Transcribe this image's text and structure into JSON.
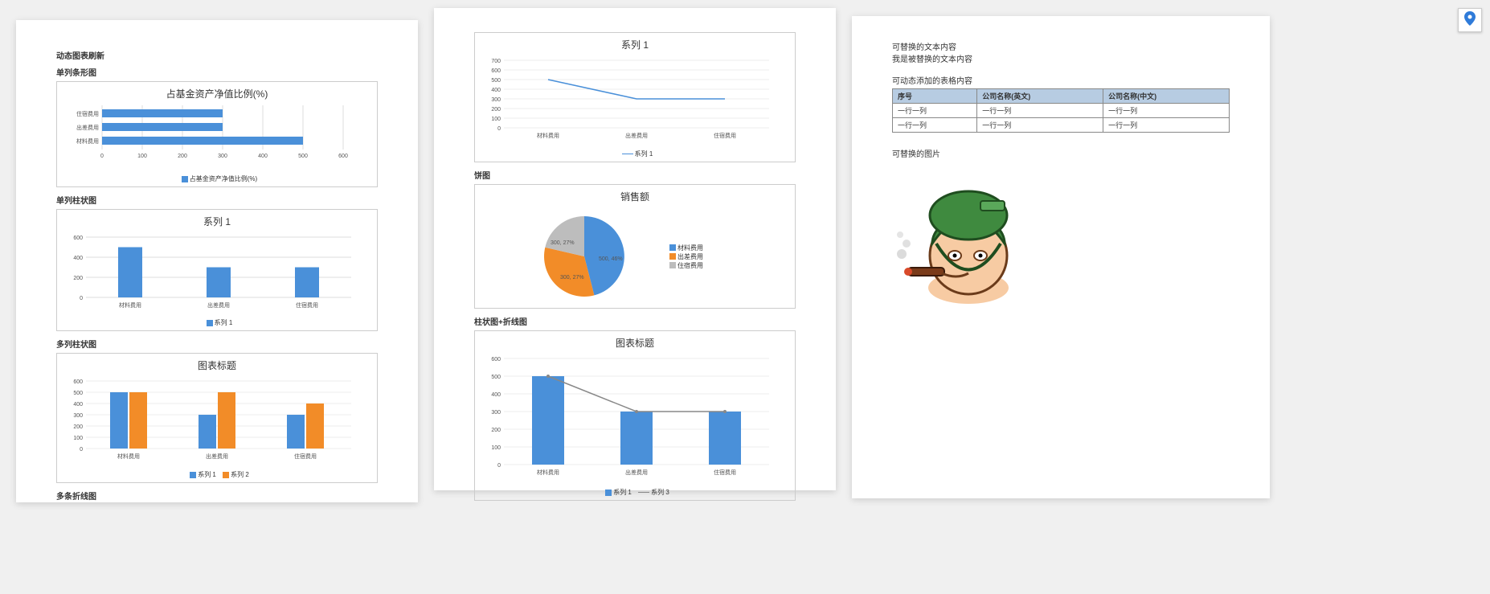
{
  "headings": {
    "main": "动态图表刷新",
    "bar_single": "单列条形图",
    "col_single": "单列柱状图",
    "col_multi": "多列柱状图",
    "line_multi": "多条折线图",
    "pie": "饼图",
    "combo": "柱状图+折线图",
    "text_section": "可替换的文本内容",
    "text_body": "我是被替换的文本内容",
    "table_section": "可动态添加的表格内容",
    "image_section": "可替换的图片"
  },
  "chart_data": [
    {
      "id": "hbar",
      "type": "bar",
      "orientation": "horizontal",
      "title": "占基金资产净值比例(%)",
      "categories": [
        "住宿费用",
        "出差费用",
        "材料费用"
      ],
      "values": [
        300,
        300,
        500
      ],
      "xlim": [
        0,
        600
      ],
      "xticks": [
        0,
        100,
        200,
        300,
        400,
        500,
        600
      ],
      "legend": [
        "占基金资产净值比例(%)"
      ],
      "colors": [
        "#4a90d9"
      ]
    },
    {
      "id": "vbar1",
      "type": "bar",
      "title": "系列 1",
      "categories": [
        "材料费用",
        "出差费用",
        "住宿费用"
      ],
      "values": [
        500,
        300,
        300
      ],
      "ylim": [
        0,
        600
      ],
      "yticks": [
        0,
        200,
        400,
        600
      ],
      "legend": [
        "系列 1"
      ],
      "colors": [
        "#4a90d9"
      ]
    },
    {
      "id": "vbar_multi",
      "type": "bar",
      "title": "图表标题",
      "categories": [
        "材料费用",
        "出差费用",
        "住宿费用"
      ],
      "series": [
        {
          "name": "系列 1",
          "values": [
            500,
            300,
            300
          ],
          "color": "#4a90d9"
        },
        {
          "name": "系列 2",
          "values": [
            500,
            500,
            400
          ],
          "color": "#f28c28"
        }
      ],
      "ylim": [
        0,
        600
      ],
      "yticks": [
        0,
        100,
        200,
        300,
        400,
        500,
        600
      ]
    },
    {
      "id": "line1",
      "type": "line",
      "title": "系列 1",
      "categories": [
        "材料费用",
        "出差费用",
        "住宿费用"
      ],
      "series": [
        {
          "name": "系列 1",
          "values": [
            500,
            300,
            300
          ],
          "color": "#4a90d9"
        }
      ],
      "ylim": [
        0,
        700
      ],
      "yticks": [
        0,
        100,
        200,
        300,
        400,
        500,
        600,
        700
      ]
    },
    {
      "id": "pie1",
      "type": "pie",
      "title": "销售额",
      "slices": [
        {
          "label": "材料费用",
          "value": 500,
          "pct": "46%",
          "color": "#4a90d9"
        },
        {
          "label": "出差费用",
          "value": 300,
          "pct": "27%",
          "color": "#f28c28"
        },
        {
          "label": "住宿费用",
          "value": 300,
          "pct": "27%",
          "color": "#bdbdbd"
        }
      ]
    },
    {
      "id": "combo1",
      "type": "combo",
      "title": "图表标题",
      "categories": [
        "材料费用",
        "出差费用",
        "住宿费用"
      ],
      "series": [
        {
          "name": "系列 1",
          "type": "bar",
          "values": [
            500,
            300,
            300
          ],
          "color": "#4a90d9"
        },
        {
          "name": "系列 3",
          "type": "line",
          "values": [
            500,
            300,
            300
          ],
          "color": "#888888"
        }
      ],
      "ylim": [
        0,
        600
      ],
      "yticks": [
        0,
        100,
        200,
        300,
        400,
        500,
        600
      ]
    }
  ],
  "table": {
    "headers": [
      "序号",
      "公司名称(英文)",
      "公司名称(中文)"
    ],
    "rows": [
      [
        "一行一列",
        "一行一列",
        "一行一列"
      ],
      [
        "一行一列",
        "一行一列",
        "一行一列"
      ]
    ]
  }
}
